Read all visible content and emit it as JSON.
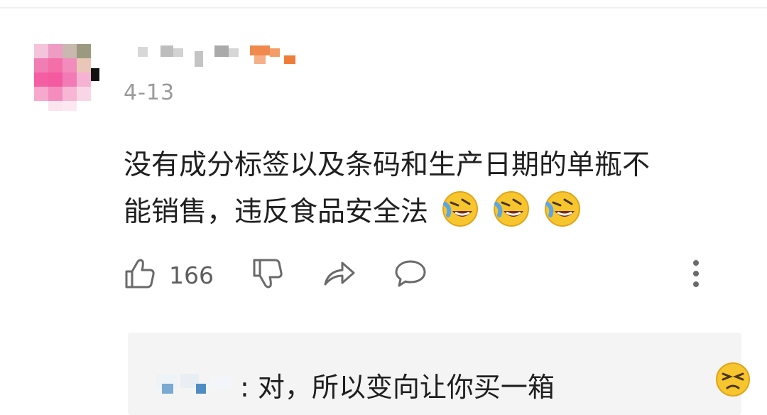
{
  "comment": {
    "date": "4-13",
    "text_line1": "没有成分标签以及条码和生产日期的单瓶不",
    "text_line2": "能销售，违反食品安全法",
    "emojis": [
      "laughing-crying-emoji",
      "laughing-crying-emoji",
      "laughing-crying-emoji"
    ],
    "like_count": "166"
  },
  "actions": {
    "like_icon": "thumbs-up-icon",
    "dislike_icon": "thumbs-down-icon",
    "share_icon": "share-icon",
    "comment_icon": "comment-bubble-icon",
    "more_icon": "more-vertical-icon"
  },
  "reply": {
    "separator": ":",
    "text": "对，所以变向让你买一箱",
    "emoji": "annoyed-face-emoji"
  },
  "colors": {
    "text_primary": "#1f1f1f",
    "text_secondary": "#9a9a9a",
    "icon_gray": "#6a6a6a",
    "reply_bg": "#f4f4f4",
    "emoji_yellow": "#f7c52e"
  }
}
